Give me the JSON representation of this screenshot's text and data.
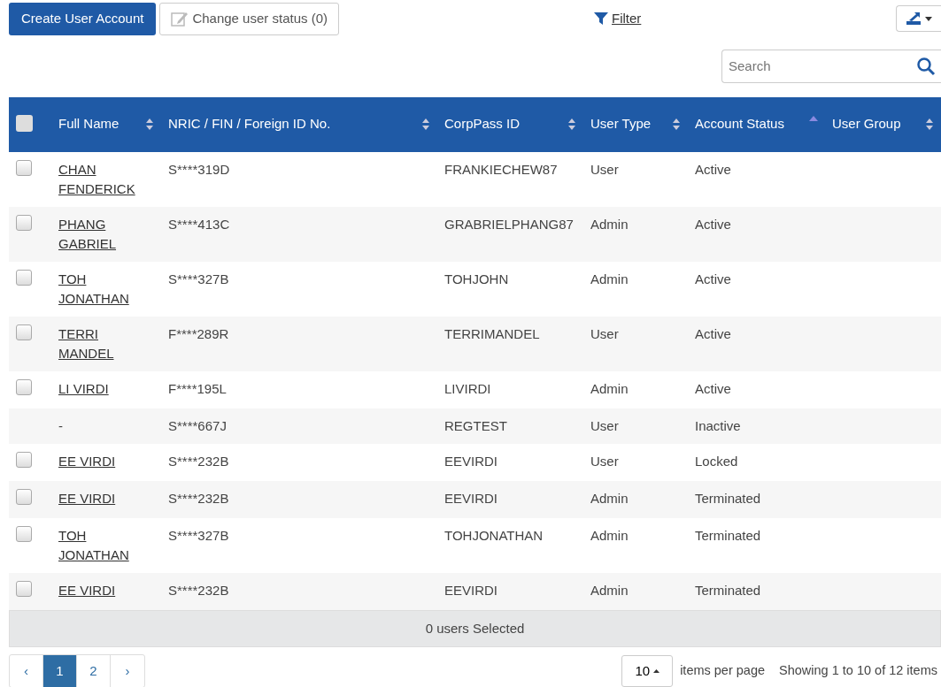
{
  "toolbar": {
    "create_button": "Create User Account",
    "status_button": "Change user status (0)",
    "filter_link": "Filter"
  },
  "search": {
    "placeholder": "Search"
  },
  "table": {
    "select_all": {
      "checked": false
    },
    "columns": [
      {
        "label": "Full Name",
        "kind": "sortable"
      },
      {
        "label": "NRIC / FIN / Foreign ID No.",
        "kind": "sortable"
      },
      {
        "label": "CorpPass ID",
        "kind": "sortable"
      },
      {
        "label": "User Type",
        "kind": "sortable"
      },
      {
        "label": "Account Status",
        "kind": "ascending"
      },
      {
        "label": "User Group",
        "kind": "sortable"
      }
    ],
    "rows": [
      {
        "kind": "link",
        "checked": false,
        "name": "CHAN FENDERICK",
        "id": "S****319D",
        "corppass": "FRANKIECHEW87",
        "type": "User",
        "status": "Active"
      },
      {
        "kind": "link",
        "checked": false,
        "name": "PHANG GABRIEL",
        "id": "S****413C",
        "corppass": "GRABRIELPHANG87",
        "type": "Admin",
        "status": "Active"
      },
      {
        "kind": "link",
        "checked": false,
        "name": "TOH JONATHAN",
        "id": "S****327B",
        "corppass": "TOHJOHN",
        "type": "Admin",
        "status": "Active"
      },
      {
        "kind": "link",
        "checked": false,
        "name": "TERRI MANDEL",
        "id": "F****289R",
        "corppass": "TERRIMANDEL",
        "type": "User",
        "status": "Active"
      },
      {
        "kind": "link",
        "checked": false,
        "name": "LI VIRDI",
        "id": "F****195L",
        "corppass": "LIVIRDI",
        "type": "Admin",
        "status": "Active"
      },
      {
        "kind": "plain",
        "name": "-",
        "id": "S****667J",
        "corppass": "REGTEST",
        "type": "User",
        "status": "Inactive"
      },
      {
        "kind": "link",
        "checked": false,
        "name": "EE VIRDI",
        "id": "S****232B",
        "corppass": "EEVIRDI",
        "type": "User",
        "status": "Locked"
      },
      {
        "kind": "link",
        "checked": false,
        "name": "EE VIRDI",
        "id": "S****232B",
        "corppass": "EEVIRDI",
        "type": "Admin",
        "status": "Terminated"
      },
      {
        "kind": "link",
        "checked": false,
        "name": "TOH JONATHAN",
        "id": "S****327B",
        "corppass": "TOHJONATHAN",
        "type": "Admin",
        "status": "Terminated"
      },
      {
        "kind": "link",
        "checked": false,
        "name": "EE VIRDI",
        "id": "S****232B",
        "corppass": "EEVIRDI",
        "type": "Admin",
        "status": "Terminated"
      }
    ],
    "footer": "0 users Selected"
  },
  "pager": {
    "prev": "‹",
    "pages": [
      {
        "label": "1",
        "selected": true
      },
      {
        "label": "2",
        "selected": false
      }
    ],
    "next": "›",
    "page_size": "10",
    "page_size_label": "items per page",
    "summary": "Showing 1 to 10 of 12 items"
  }
}
